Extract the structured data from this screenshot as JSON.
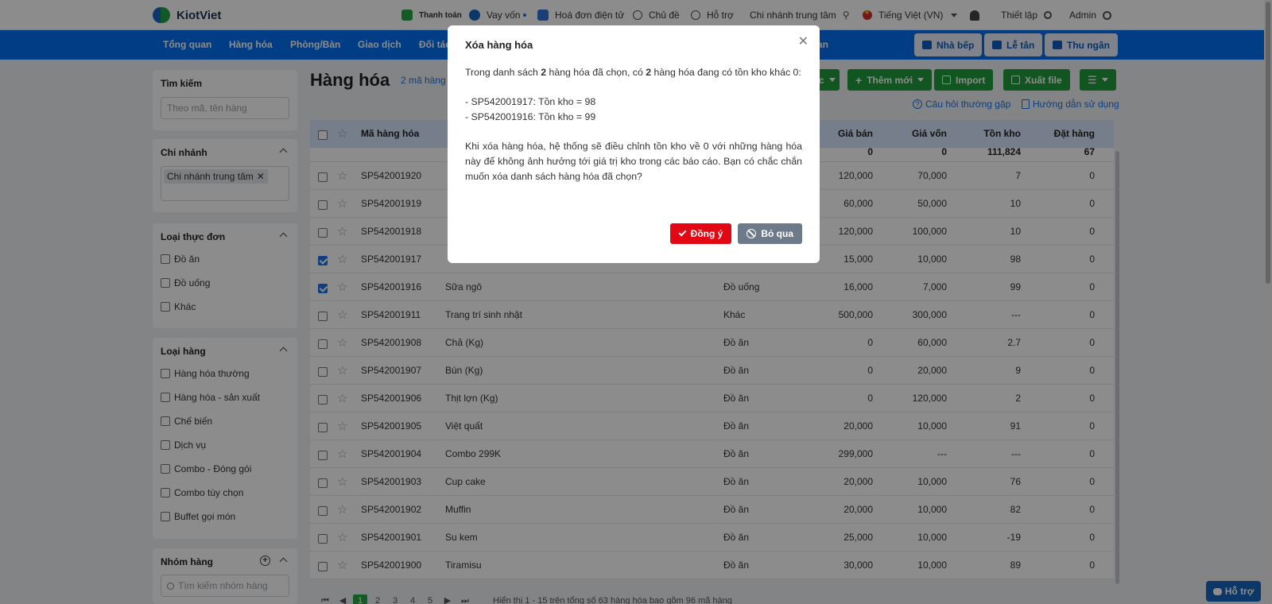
{
  "topbar": {
    "brand": "KiotViet",
    "links": [
      {
        "label": "Thanh toán",
        "icon": "payment-icon"
      },
      {
        "label": "Vay vốn",
        "icon": "money-bag-icon"
      },
      {
        "label": "Hoá đơn điện tử",
        "icon": "e-invoice-icon"
      },
      {
        "label": "Chủ đề",
        "icon": "palette-icon"
      },
      {
        "label": "Hỗ trợ",
        "icon": "chat-icon"
      }
    ],
    "branch": "Chi nhánh trung tâm",
    "language": "Tiếng Việt (VN)",
    "settings": "Thiết lập",
    "user": "Admin"
  },
  "mainnav": {
    "items": [
      "Tổng quan",
      "Hàng hóa",
      "Phòng/Bàn",
      "Giao dịch",
      "Đối tác"
    ],
    "partial_item": "an",
    "buttons": [
      "Nhà bếp",
      "Lễ tân",
      "Thu ngân"
    ]
  },
  "sidebar": {
    "search": {
      "title": "Tìm kiếm",
      "placeholder": "Theo mã, tên hàng"
    },
    "branch": {
      "title": "Chi nhánh",
      "tag": "Chi nhánh trung tâm"
    },
    "menu_type": {
      "title": "Loại thực đơn",
      "options": [
        "Đồ ăn",
        "Đồ uống",
        "Khác"
      ]
    },
    "product_type": {
      "title": "Loại hàng",
      "options": [
        "Hàng hóa thường",
        "Hàng hóa - sản xuất",
        "Chế biến",
        "Dịch vụ",
        "Combo - Đóng gói",
        "Combo tùy chọn",
        "Buffet gọi món"
      ]
    },
    "group": {
      "title": "Nhóm hàng",
      "placeholder": "Tìm kiếm nhóm hàng"
    }
  },
  "content": {
    "title": "Hàng hóa",
    "summary_link": "2 mã hàng",
    "buttons": {
      "partial": "c",
      "add": "Thêm mới",
      "import": "Import",
      "export": "Xuất file"
    },
    "help": {
      "faq": "Câu hỏi thường gặp",
      "guide": "Hướng dẫn sử dụng"
    }
  },
  "table": {
    "headers": {
      "code": "Mã hàng hóa",
      "price": "Giá bán",
      "cost": "Giá vốn",
      "stock": "Tồn kho",
      "ordered": "Đặt hàng"
    },
    "totals": {
      "price": "0",
      "cost": "0",
      "stock": "111,824",
      "ordered": "67"
    },
    "rows": [
      {
        "code": "SP542001920",
        "name": "",
        "type": "",
        "price": "120,000",
        "cost": "70,000",
        "stock": "7",
        "ordered": "0",
        "checked": false
      },
      {
        "code": "SP542001919",
        "name": "",
        "type": "",
        "price": "60,000",
        "cost": "50,000",
        "stock": "10",
        "ordered": "0",
        "checked": false
      },
      {
        "code": "SP542001918",
        "name": "",
        "type": "",
        "price": "120,000",
        "cost": "100,000",
        "stock": "10",
        "ordered": "0",
        "checked": false
      },
      {
        "code": "SP542001917",
        "name": "",
        "type": "",
        "price": "15,000",
        "cost": "10,000",
        "stock": "98",
        "ordered": "0",
        "checked": true
      },
      {
        "code": "SP542001916",
        "name": "Sữa ngô",
        "type": "Đồ uống",
        "price": "16,000",
        "cost": "7,000",
        "stock": "99",
        "ordered": "0",
        "checked": true
      },
      {
        "code": "SP542001911",
        "name": "Trang trí sinh nhật",
        "type": "Khác",
        "price": "500,000",
        "cost": "300,000",
        "stock": "---",
        "ordered": "0",
        "checked": false
      },
      {
        "code": "SP542001908",
        "name": "Chả (Kg)",
        "type": "Đồ ăn",
        "price": "0",
        "cost": "60,000",
        "stock": "2.7",
        "ordered": "0",
        "checked": false
      },
      {
        "code": "SP542001907",
        "name": "Bún (Kg)",
        "type": "Đồ ăn",
        "price": "0",
        "cost": "20,000",
        "stock": "9",
        "ordered": "0",
        "checked": false
      },
      {
        "code": "SP542001906",
        "name": "Thịt lợn (Kg)",
        "type": "Đồ ăn",
        "price": "0",
        "cost": "120,000",
        "stock": "2",
        "ordered": "0",
        "checked": false
      },
      {
        "code": "SP542001905",
        "name": "Việt quất",
        "type": "Đồ ăn",
        "price": "20,000",
        "cost": "10,000",
        "stock": "91",
        "ordered": "0",
        "checked": false
      },
      {
        "code": "SP542001904",
        "name": "Combo 299K",
        "type": "Đồ ăn",
        "price": "299,000",
        "cost": "---",
        "stock": "---",
        "ordered": "0",
        "checked": false
      },
      {
        "code": "SP542001903",
        "name": "Cup cake",
        "type": "Đồ ăn",
        "price": "20,000",
        "cost": "10,000",
        "stock": "76",
        "ordered": "0",
        "checked": false
      },
      {
        "code": "SP542001902",
        "name": "Muffin",
        "type": "Đồ ăn",
        "price": "20,000",
        "cost": "10,000",
        "stock": "82",
        "ordered": "0",
        "checked": false
      },
      {
        "code": "SP542001901",
        "name": "Su kem",
        "type": "Đồ ăn",
        "price": "25,000",
        "cost": "10,000",
        "stock": "-19",
        "ordered": "0",
        "checked": false
      },
      {
        "code": "SP542001900",
        "name": "Tiramisu",
        "type": "Đồ ăn",
        "price": "30,000",
        "cost": "10,000",
        "stock": "89",
        "ordered": "0",
        "checked": false
      }
    ]
  },
  "pagination": {
    "pages": [
      "1",
      "2",
      "3",
      "4",
      "5"
    ],
    "active": "1",
    "info": "Hiển thị 1 - 15 trên tổng số 63 hàng hóa bao gồm 96 mã hàng"
  },
  "support_button": "Hỗ trợ",
  "modal": {
    "title": "Xóa hàng hóa",
    "line1_a": "Trong danh sách ",
    "line1_count1": "2",
    "line1_b": " hàng hóa đã chọn, có ",
    "line1_count2": "2",
    "line1_c": " hàng hóa đang có tồn kho khác 0:",
    "items": [
      "- SP542001917: Tồn kho = 98",
      "- SP542001916: Tồn kho = 99"
    ],
    "warning": "Khi xóa hàng hóa, hệ thống sẽ điều chỉnh tồn kho về 0 với những hàng hóa này để không ảnh hưởng tới giá trị kho trong các báo cáo. Bạn có chắc chắn muốn xóa danh sách hàng hóa đã chọn?",
    "confirm": "Đồng ý",
    "cancel": "Bỏ qua"
  },
  "colors": {
    "nav_blue": "#0070f0",
    "green": "#1f9d3b",
    "danger": "#e30613",
    "cancel_gray": "#6c7a89"
  }
}
